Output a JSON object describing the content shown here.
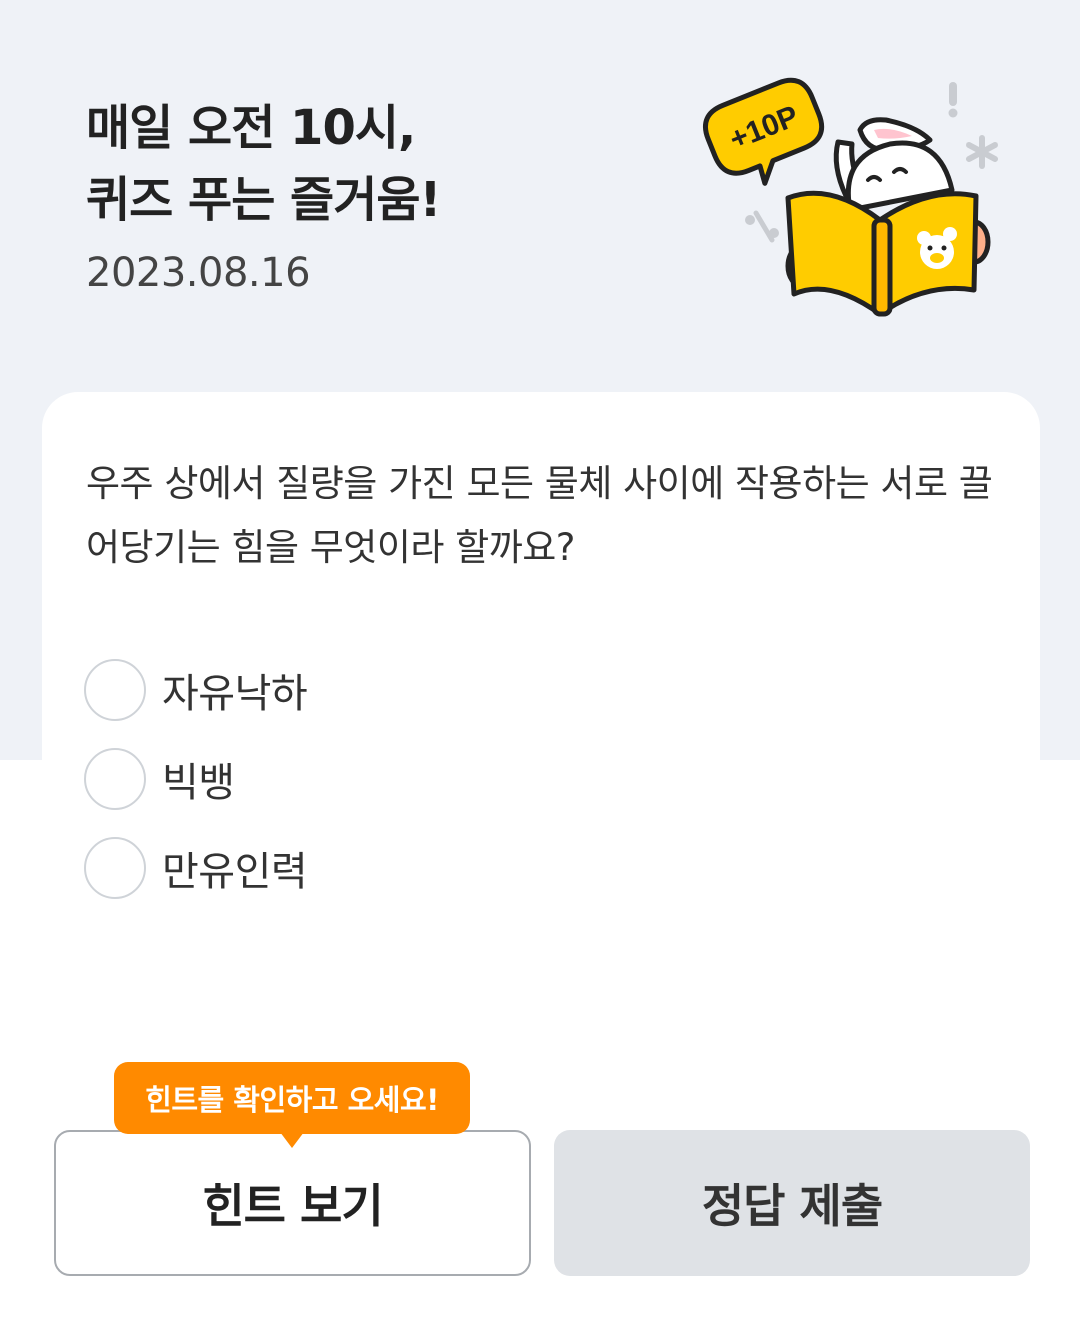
{
  "header": {
    "headline_line1": "매일 오전 10시,",
    "headline_line2": "퀴즈 푸는 즐거움!",
    "date": "2023.08.16",
    "badge_text": "+10P"
  },
  "quiz": {
    "question": "우주 상에서 질량을 가진 모든 물체 사이에 작용하는 서로 끌어당기는 힘을 무엇이라 할까요?",
    "options": [
      {
        "label": "자유낙하",
        "selected": false
      },
      {
        "label": "빅뱅",
        "selected": false
      },
      {
        "label": "만유인력",
        "selected": false
      }
    ]
  },
  "actions": {
    "tooltip": "힌트를 확인하고 오세요!",
    "hint_button": "힌트 보기",
    "submit_button": "정답 제출"
  },
  "colors": {
    "header_bg": "#eff2f7",
    "accent_orange": "#ff8a00",
    "illustration_yellow": "#ffcc00",
    "submit_bg": "#dfe2e6"
  },
  "icons": {
    "illustration": "rabbit-reading-book-illustration",
    "option_marker": "radio-circle"
  }
}
